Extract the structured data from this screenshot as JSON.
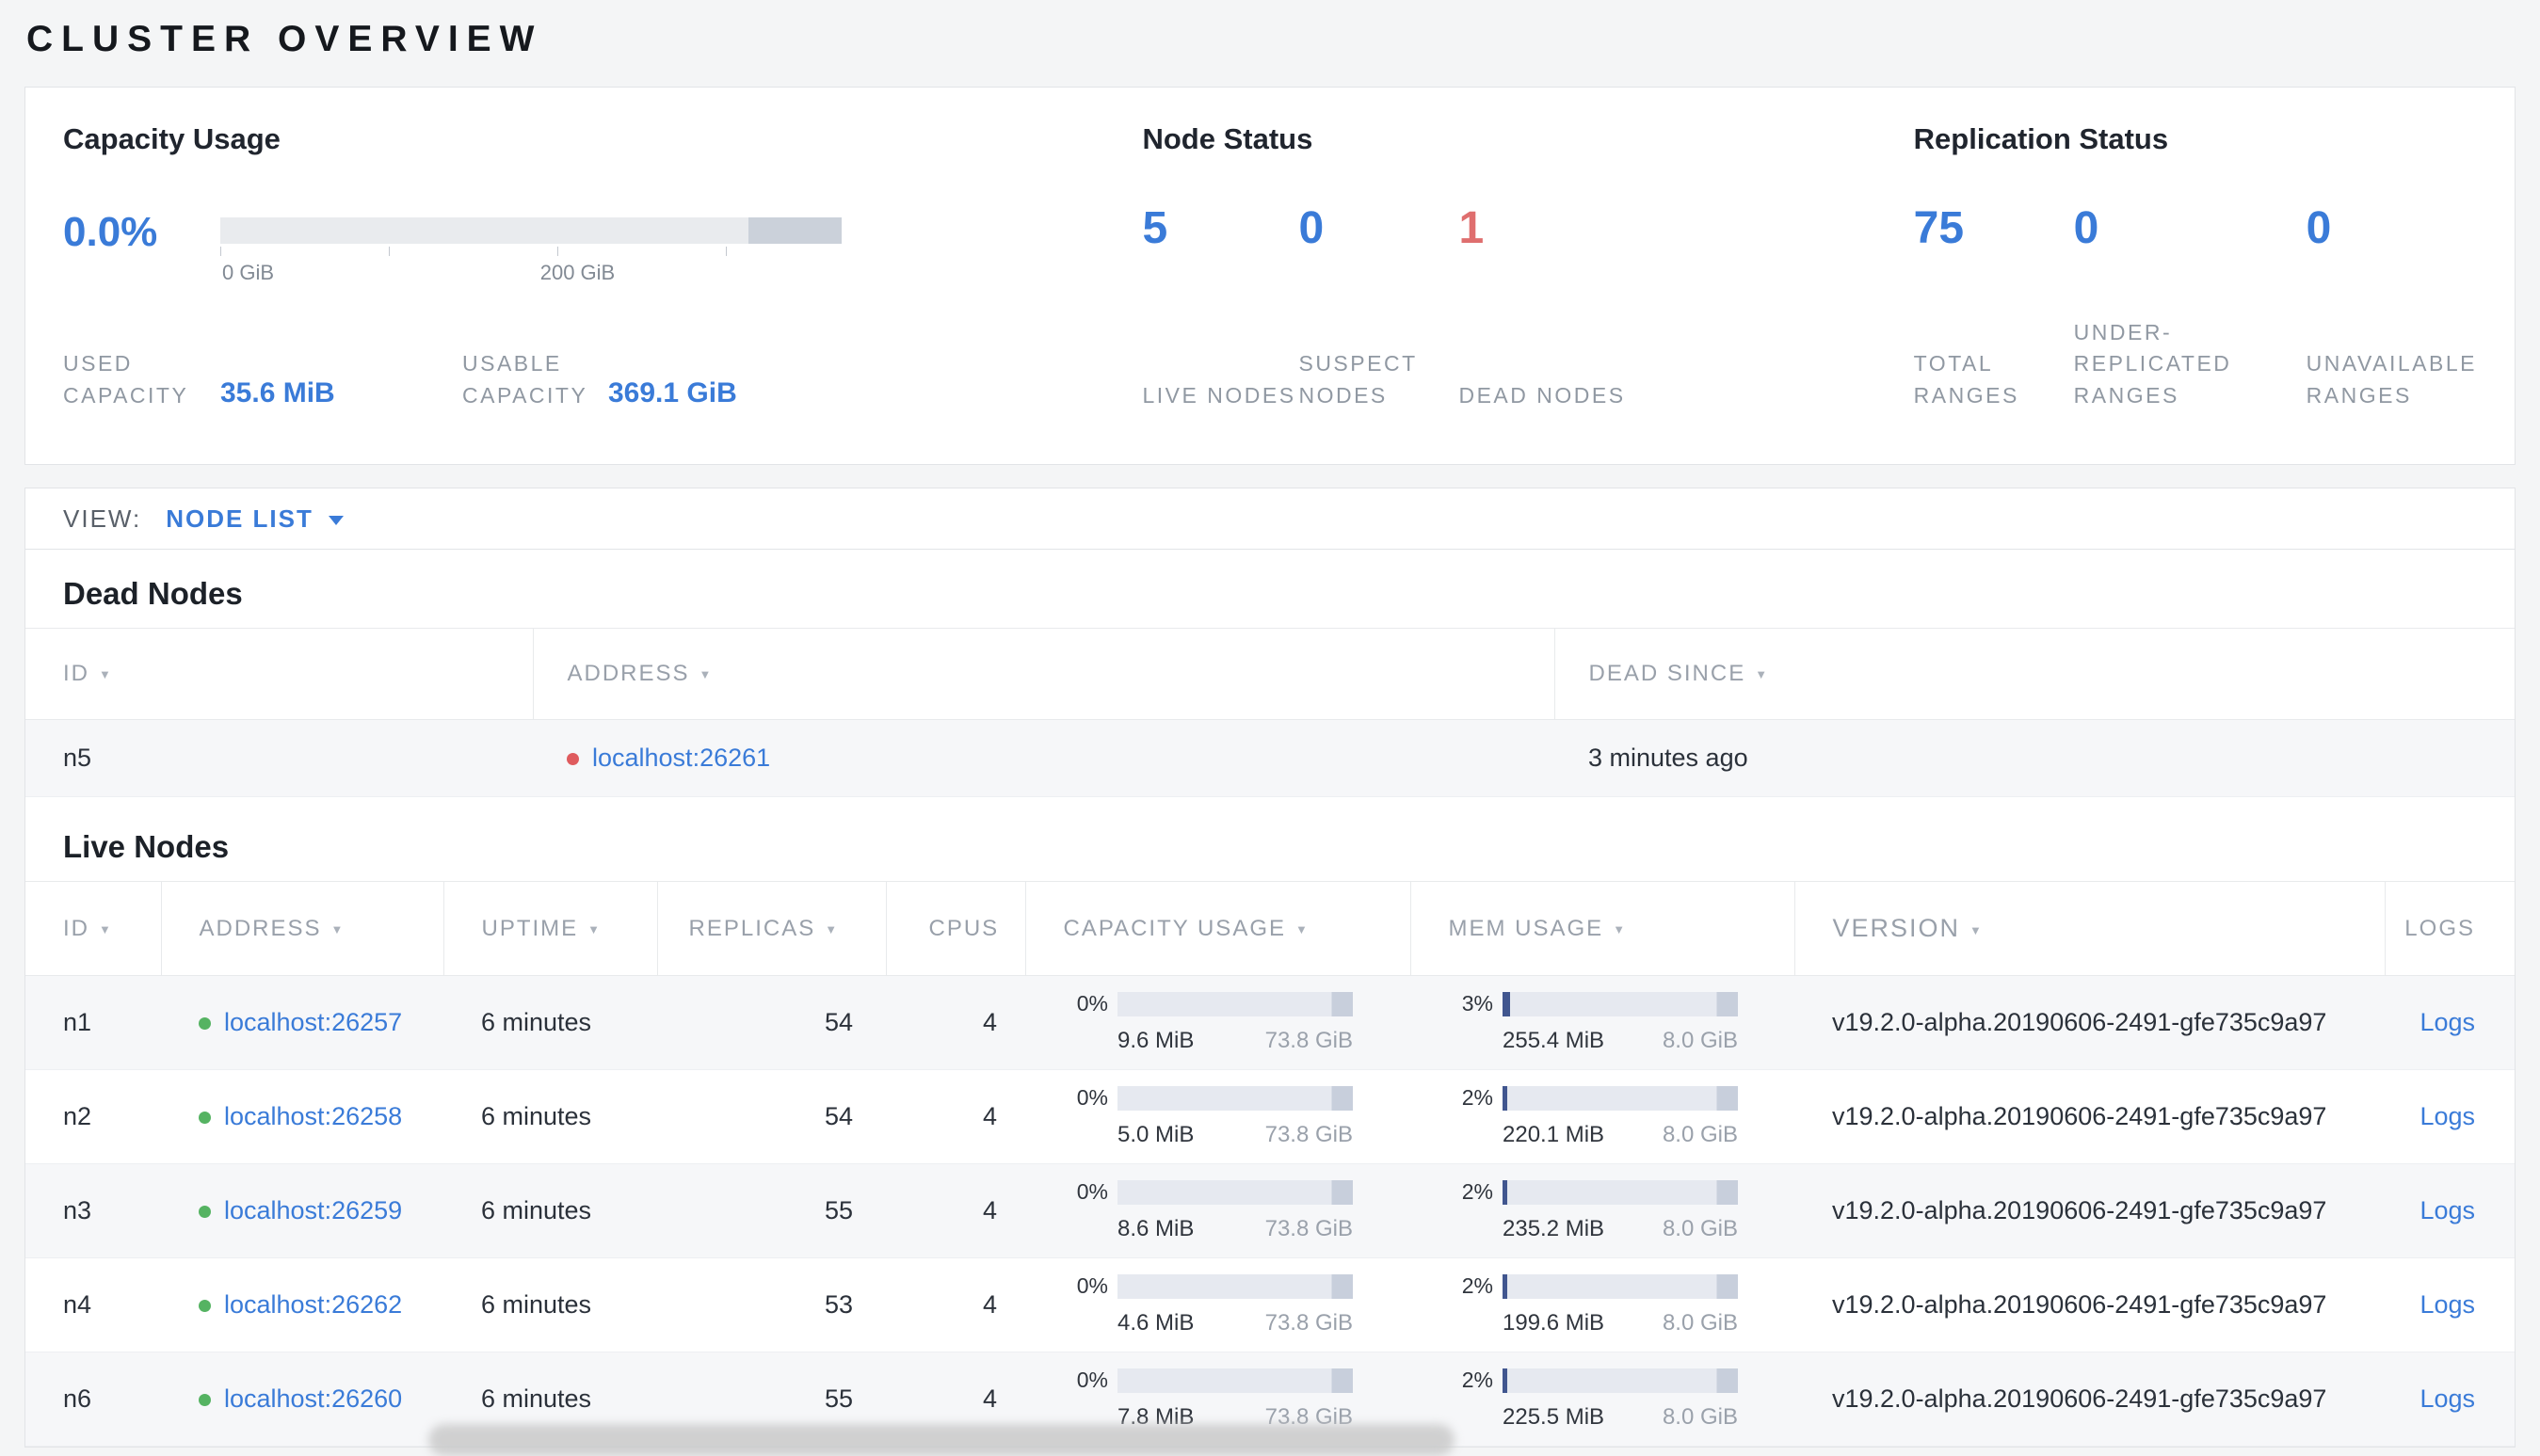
{
  "colors": {
    "accent_blue": "#3a7bd8",
    "danger_red": "#df6e6e",
    "dead_dot_red": "#df5b5e",
    "live_dot_green": "#55b362",
    "mem_fill_blue": "#41568f"
  },
  "page": {
    "title": "CLUSTER OVERVIEW"
  },
  "summary": {
    "capacity": {
      "title": "Capacity Usage",
      "percent": "0.0%",
      "chart_data": {
        "type": "bar",
        "axis_tick_labels": [
          "0 GiB",
          "200 GiB"
        ],
        "axis_range_gib": [
          0,
          369.1
        ],
        "used_fraction": 0.0
      },
      "stats": [
        {
          "label": "USED CAPACITY",
          "value": "35.6 MiB"
        },
        {
          "label": "USABLE CAPACITY",
          "value": "369.1 GiB"
        }
      ]
    },
    "node_status": {
      "title": "Node Status",
      "stats": [
        {
          "value": "5",
          "label": "LIVE NODES"
        },
        {
          "value": "0",
          "label": "SUSPECT NODES"
        },
        {
          "value": "1",
          "label": "DEAD NODES"
        }
      ]
    },
    "replication": {
      "title": "Replication Status",
      "stats": [
        {
          "value": "75",
          "label": "TOTAL RANGES"
        },
        {
          "value": "0",
          "label": "UNDER-REPLICATED RANGES"
        },
        {
          "value": "0",
          "label": "UNAVAILABLE RANGES"
        }
      ]
    }
  },
  "view_bar": {
    "label": "VIEW:",
    "selected": "NODE LIST"
  },
  "dead_nodes": {
    "title": "Dead Nodes",
    "columns": {
      "id": "ID",
      "address": "ADDRESS",
      "dead_since": "DEAD SINCE"
    },
    "rows": [
      {
        "id": "n5",
        "address": "localhost:26261",
        "dead_since": "3 minutes ago"
      }
    ]
  },
  "live_nodes": {
    "title": "Live Nodes",
    "columns": {
      "id": "ID",
      "address": "ADDRESS",
      "uptime": "UPTIME",
      "replicas": "REPLICAS",
      "cpus": "CPUS",
      "capacity": "CAPACITY USAGE",
      "mem": "MEM USAGE",
      "version": "VERSION",
      "logs": "LOGS"
    },
    "rows": [
      {
        "id": "n1",
        "address": "localhost:26257",
        "uptime": "6 minutes",
        "replicas": "54",
        "cpus": "4",
        "capacity_pct": "0%",
        "capacity_fill": 0,
        "capacity_used": "9.6 MiB",
        "capacity_total": "73.8 GiB",
        "mem_pct": "3%",
        "mem_fill": 3,
        "mem_used": "255.4 MiB",
        "mem_total": "8.0 GiB",
        "version": "v19.2.0-alpha.20190606-2491-gfe735c9a97",
        "logs": "Logs"
      },
      {
        "id": "n2",
        "address": "localhost:26258",
        "uptime": "6 minutes",
        "replicas": "54",
        "cpus": "4",
        "capacity_pct": "0%",
        "capacity_fill": 0,
        "capacity_used": "5.0 MiB",
        "capacity_total": "73.8 GiB",
        "mem_pct": "2%",
        "mem_fill": 2,
        "mem_used": "220.1 MiB",
        "mem_total": "8.0 GiB",
        "version": "v19.2.0-alpha.20190606-2491-gfe735c9a97",
        "logs": "Logs"
      },
      {
        "id": "n3",
        "address": "localhost:26259",
        "uptime": "6 minutes",
        "replicas": "55",
        "cpus": "4",
        "capacity_pct": "0%",
        "capacity_fill": 0,
        "capacity_used": "8.6 MiB",
        "capacity_total": "73.8 GiB",
        "mem_pct": "2%",
        "mem_fill": 2,
        "mem_used": "235.2 MiB",
        "mem_total": "8.0 GiB",
        "version": "v19.2.0-alpha.20190606-2491-gfe735c9a97",
        "logs": "Logs"
      },
      {
        "id": "n4",
        "address": "localhost:26262",
        "uptime": "6 minutes",
        "replicas": "53",
        "cpus": "4",
        "capacity_pct": "0%",
        "capacity_fill": 0,
        "capacity_used": "4.6 MiB",
        "capacity_total": "73.8 GiB",
        "mem_pct": "2%",
        "mem_fill": 2,
        "mem_used": "199.6 MiB",
        "mem_total": "8.0 GiB",
        "version": "v19.2.0-alpha.20190606-2491-gfe735c9a97",
        "logs": "Logs"
      },
      {
        "id": "n6",
        "address": "localhost:26260",
        "uptime": "6 minutes",
        "replicas": "55",
        "cpus": "4",
        "capacity_pct": "0%",
        "capacity_fill": 0,
        "capacity_used": "7.8 MiB",
        "capacity_total": "73.8 GiB",
        "mem_pct": "2%",
        "mem_fill": 2,
        "mem_used": "225.5 MiB",
        "mem_total": "8.0 GiB",
        "version": "v19.2.0-alpha.20190606-2491-gfe735c9a97",
        "logs": "Logs"
      }
    ]
  }
}
